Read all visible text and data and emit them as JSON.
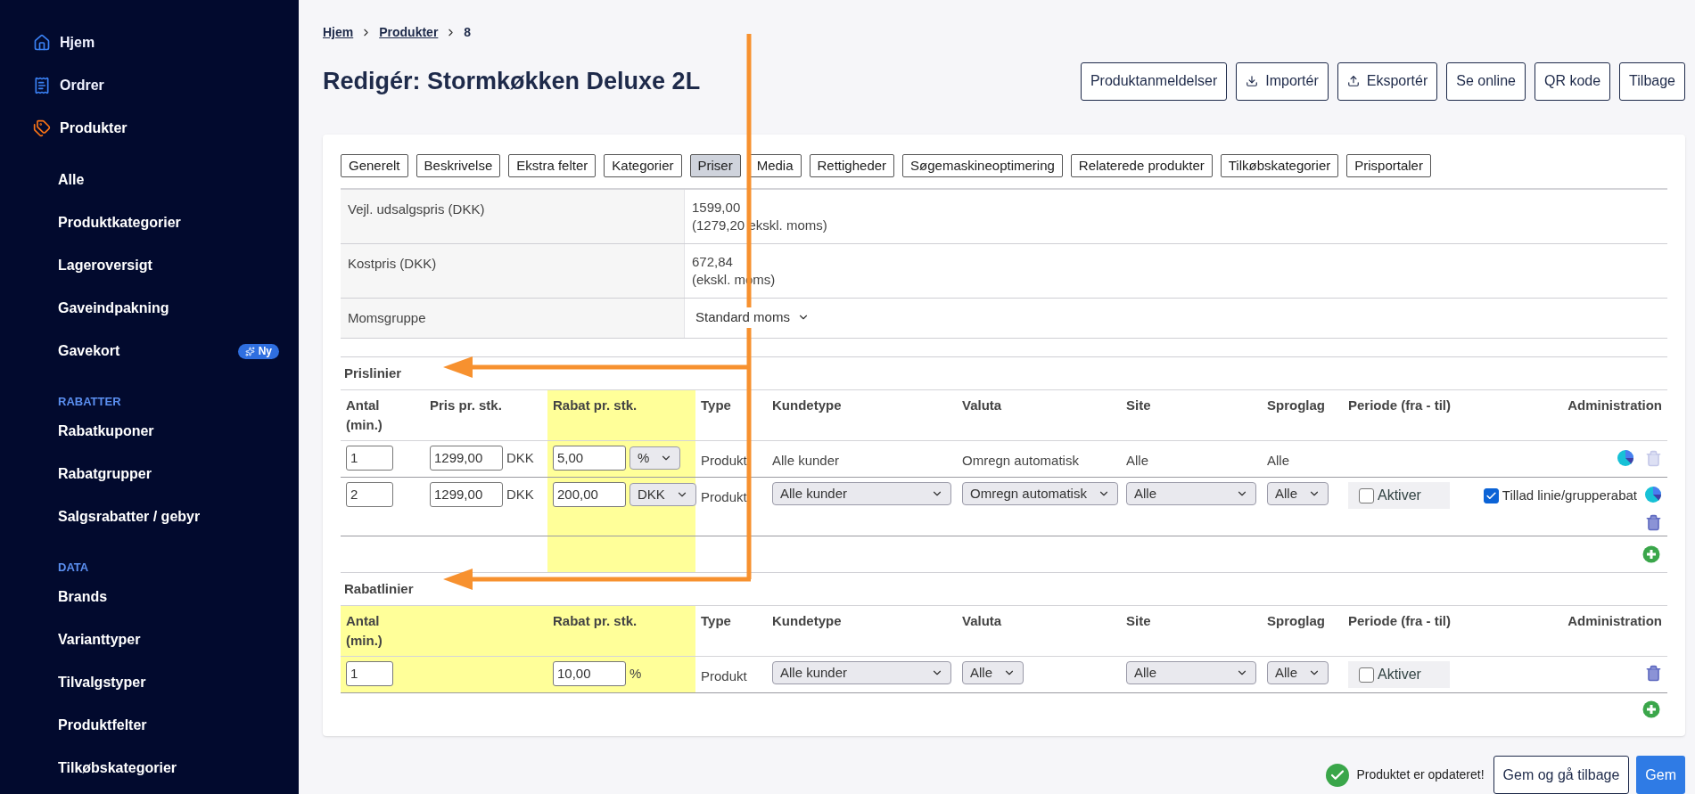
{
  "sidebar": {
    "main_items": [
      {
        "label": "Hjem",
        "kind": "home",
        "selected": false
      },
      {
        "label": "Ordrer",
        "kind": "orders",
        "selected": false
      },
      {
        "label": "Produkter",
        "kind": "tag",
        "selected": true
      }
    ],
    "sub_items": [
      {
        "label": "Alle"
      },
      {
        "label": "Produktkategorier"
      },
      {
        "label": "Lageroversigt"
      },
      {
        "label": "Gaveindpakning"
      },
      {
        "label": "Gavekort",
        "badge": "Ny"
      }
    ],
    "sections": [
      {
        "heading": "RABATTER",
        "items": [
          "Rabatkuponer",
          "Rabatgrupper",
          "Salgsrabatter / gebyr"
        ]
      },
      {
        "heading": "DATA",
        "items": [
          "Brands",
          "Varianttyper",
          "Tilvalgstyper",
          "Produktfelter",
          "Tilkøbskategorier"
        ]
      }
    ]
  },
  "breadcrumb": [
    {
      "label": "Hjem",
      "link": true
    },
    {
      "label": "Produkter",
      "link": true
    },
    {
      "label": "8",
      "link": false
    }
  ],
  "title": "Redigér: Stormkøkken Deluxe 2L",
  "header_buttons": [
    {
      "label": "Produktanmeldelser"
    },
    {
      "label": "Importér",
      "kind": "download"
    },
    {
      "label": "Eksportér",
      "kind": "upload"
    },
    {
      "label": "Se online"
    },
    {
      "label": "QR kode"
    },
    {
      "label": "Tilbage"
    }
  ],
  "tabs": [
    {
      "label": "Generelt",
      "selected": false
    },
    {
      "label": "Beskrivelse",
      "selected": false
    },
    {
      "label": "Ekstra felter",
      "selected": false
    },
    {
      "label": "Kategorier",
      "selected": false
    },
    {
      "label": "Priser",
      "selected": true
    },
    {
      "label": "Media",
      "selected": false
    },
    {
      "label": "Rettigheder",
      "selected": false
    },
    {
      "label": "Søgemaskineoptimering",
      "selected": false
    },
    {
      "label": "Relaterede produkter",
      "selected": false
    },
    {
      "label": "Tilkøbskategorier",
      "selected": false
    },
    {
      "label": "Prisportaler",
      "selected": false
    }
  ],
  "info_rows": [
    {
      "label": "Vejl. udsalgspris (DKK)",
      "kind": "text",
      "lines": [
        "1599,00",
        "(1279,20 ekskl. moms)"
      ]
    },
    {
      "label": "Kostpris (DKK)",
      "kind": "text",
      "lines": [
        "672,84",
        "(ekskl. moms)"
      ]
    },
    {
      "label": "Momsgruppe",
      "kind": "select",
      "value": "Standard moms"
    }
  ],
  "tables": [
    {
      "title": "Prislinier",
      "columns": [
        {
          "label": "Antal (min.)",
          "highlighted": false
        },
        {
          "label": "Pris pr. stk.",
          "highlighted": false
        },
        {
          "label": "Rabat pr. stk.",
          "highlighted": true
        },
        {
          "label": "Type",
          "highlighted": false
        },
        {
          "label": "Kundetype",
          "highlighted": false
        },
        {
          "label": "Valuta",
          "highlighted": false
        },
        {
          "label": "Site",
          "highlighted": false
        },
        {
          "label": "Sproglag",
          "highlighted": false
        },
        {
          "label": "Periode (fra - til)",
          "highlighted": false
        },
        {
          "label": "Administration",
          "highlighted": false
        }
      ],
      "rows": [
        {
          "cells": [
            {
              "kind": "input",
              "value": "1"
            },
            {
              "kind": "input",
              "value": "1299,00",
              "unit": {
                "kind": "text",
                "value": "DKK"
              }
            },
            {
              "kind": "input",
              "value": "5,00",
              "unit": {
                "kind": "select",
                "value": "%"
              }
            },
            {
              "kind": "text",
              "value": "Produkt"
            },
            {
              "kind": "text",
              "value": "Alle kunder"
            },
            {
              "kind": "text",
              "value": "Omregn automatisk"
            },
            {
              "kind": "text",
              "value": "Alle"
            },
            {
              "kind": "text",
              "value": "Alle"
            },
            null,
            {
              "kind": "admin",
              "chart": true,
              "trash_disabled": true
            }
          ]
        },
        {
          "cells": [
            {
              "kind": "input",
              "value": "2"
            },
            {
              "kind": "input",
              "value": "1299,00",
              "unit": {
                "kind": "text",
                "value": "DKK"
              }
            },
            {
              "kind": "input",
              "value": "200,00",
              "unit": {
                "kind": "select",
                "value": "DKK"
              }
            },
            {
              "kind": "text",
              "value": "Produkt"
            },
            {
              "kind": "select",
              "value": "Alle kunder"
            },
            {
              "kind": "select",
              "value": "Omregn automatisk"
            },
            {
              "kind": "select",
              "value": "Alle"
            },
            {
              "kind": "select",
              "value": "Alle"
            },
            {
              "kind": "checkbox",
              "label": "Aktiver",
              "checked": false
            },
            {
              "kind": "admin",
              "option": {
                "label": "Tillad linie/grupperabat",
                "checked": true
              },
              "chart": true,
              "trash_disabled": false
            }
          ]
        }
      ]
    },
    {
      "title": "Rabatlinier",
      "columns": [
        {
          "label": "Antal (min.)",
          "highlighted": true
        },
        {
          "highlighted": true
        },
        {
          "label": "Rabat pr. stk.",
          "highlighted": true
        },
        {
          "label": "Type",
          "highlighted": false
        },
        {
          "label": "Kundetype",
          "highlighted": false
        },
        {
          "label": "Valuta",
          "highlighted": false
        },
        {
          "label": "Site",
          "highlighted": false
        },
        {
          "label": "Sproglag",
          "highlighted": false
        },
        {
          "label": "Periode (fra - til)",
          "highlighted": false
        },
        {
          "label": "Administration",
          "highlighted": false
        }
      ],
      "rows": [
        {
          "cells": [
            {
              "kind": "input",
              "value": "1"
            },
            null,
            {
              "kind": "input",
              "value": "10,00",
              "unit": {
                "kind": "text",
                "value": "%"
              }
            },
            {
              "kind": "text",
              "value": "Produkt"
            },
            {
              "kind": "select",
              "value": "Alle kunder"
            },
            {
              "kind": "select",
              "value": "Alle"
            },
            {
              "kind": "select",
              "value": "Alle"
            },
            {
              "kind": "select",
              "value": "Alle"
            },
            {
              "kind": "checkbox",
              "label": "Aktiver",
              "checked": false
            },
            {
              "kind": "admin",
              "chart": false,
              "trash_disabled": false
            }
          ]
        }
      ]
    }
  ],
  "footer": {
    "status": "Produktet er opdateret!",
    "buttons": [
      {
        "label": "Gem og gå tilbage",
        "kind": "secondary"
      },
      {
        "label": "Gem",
        "kind": "primary"
      }
    ]
  }
}
